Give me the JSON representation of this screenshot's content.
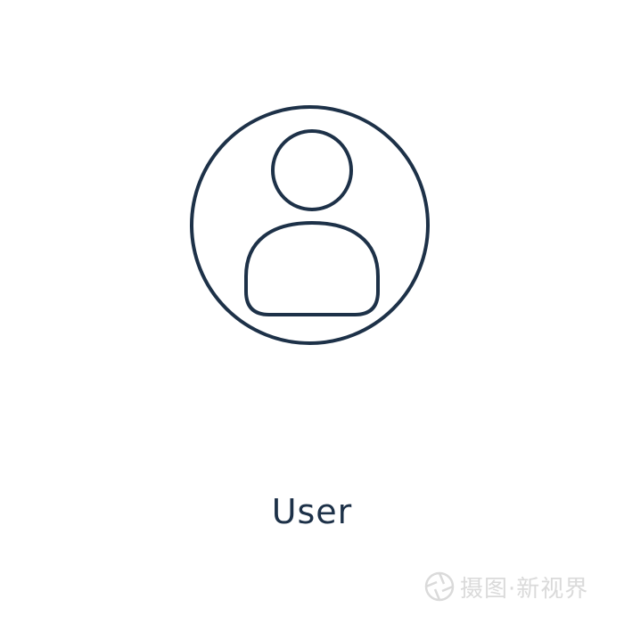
{
  "icon": {
    "name": "user-icon",
    "stroke_color": "#1d3148"
  },
  "caption": {
    "text": "User"
  },
  "watermark": {
    "logo_icon": "camera-aperture-icon",
    "text": "摄图·新视界",
    "color": "#d4d4d4"
  }
}
